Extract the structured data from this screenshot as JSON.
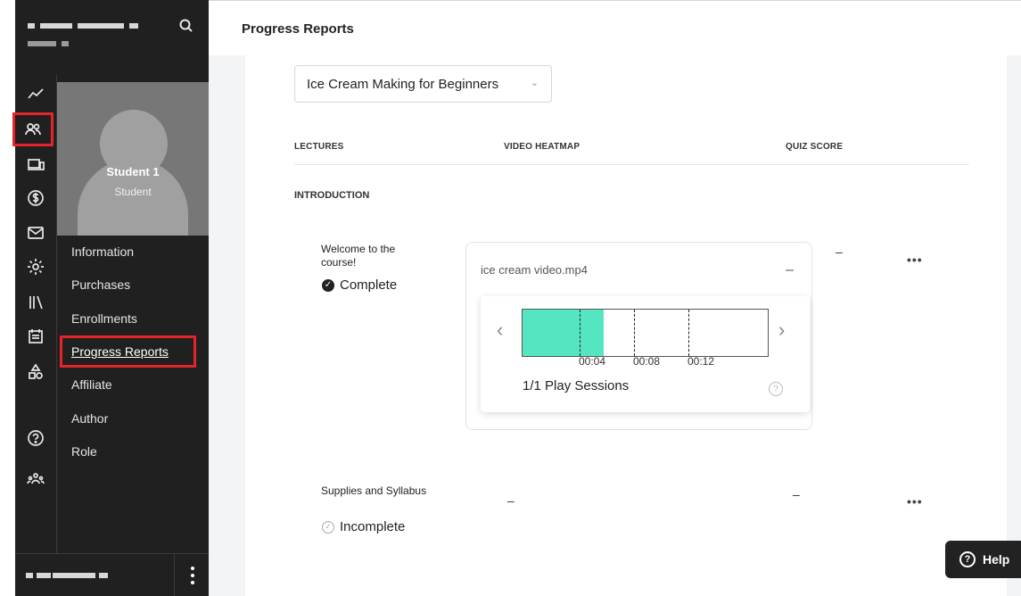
{
  "page": {
    "title": "Progress Reports"
  },
  "profile": {
    "name": "Student 1",
    "role": "Student"
  },
  "subnav": {
    "items": [
      {
        "label": "Information"
      },
      {
        "label": "Purchases"
      },
      {
        "label": "Enrollments"
      },
      {
        "label": "Progress Reports"
      },
      {
        "label": "Affiliate"
      },
      {
        "label": "Author"
      },
      {
        "label": "Role"
      }
    ],
    "active": "Progress Reports"
  },
  "rail_icons": [
    "analytics-icon",
    "users-icon",
    "devices-icon",
    "dollar-icon",
    "mail-icon",
    "settings-icon",
    "library-icon",
    "calendar-icon",
    "shapes-icon",
    "help-icon",
    "team-icon"
  ],
  "course_select": {
    "value": "Ice Cream Making for Beginners"
  },
  "table": {
    "columns": [
      "LECTURES",
      "VIDEO HEATMAP",
      "QUIZ SCORE"
    ],
    "section": "INTRODUCTION",
    "rows": [
      {
        "title": "Welcome to the course!",
        "status": "Complete",
        "quiz": "–",
        "more": "•••"
      },
      {
        "title": "Supplies and Syllabus",
        "status": "Incomplete",
        "heatmap": "–",
        "quiz": "–",
        "more": "•••"
      }
    ]
  },
  "heatmap": {
    "file": "ice cream video.mp4",
    "collapse": "–",
    "ticks": [
      "00:04",
      "00:08",
      "00:12"
    ],
    "watched_fraction": 0.33,
    "sessions": "1/1 Play Sessions",
    "help": "?",
    "prev": "‹",
    "next": "›"
  },
  "help_button": {
    "label": "Help",
    "icon": "?"
  },
  "colors": {
    "sidebar": "#202020",
    "heat": "#55e6c1",
    "highlight": "#e3242b"
  }
}
